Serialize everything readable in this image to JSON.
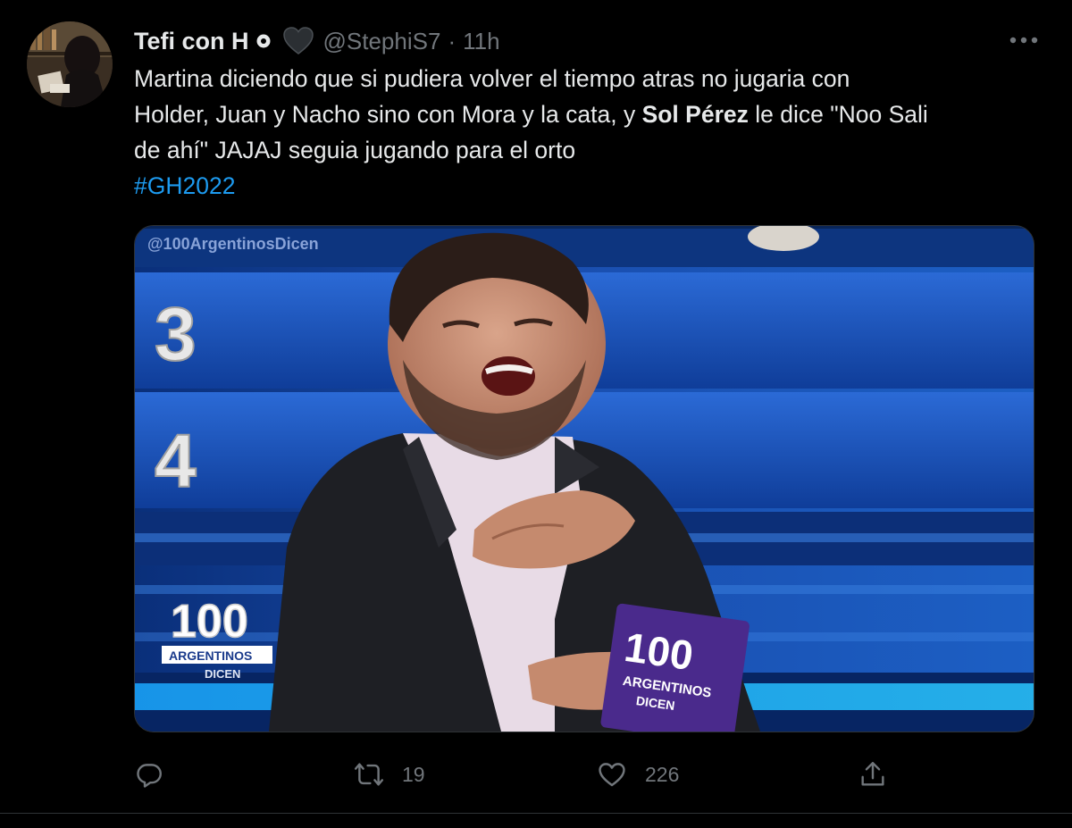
{
  "tweet": {
    "display_name": "Tefi con H",
    "handle": "@StephiS7",
    "separator": "·",
    "time": "11h",
    "text_line1": "Martina diciendo que si pudiera volver el tiempo atras no jugaria con",
    "text_line2_a": "Holder, Juan y Nacho sino con Mora y la cata, y ",
    "text_line2_bold": "Sol Pérez",
    "text_line2_b": " le dice \"Noo Sali",
    "text_line3": "de ahí\" JAJAJ seguia jugando para el orto",
    "hashtag": "#GH2022"
  },
  "media": {
    "board_numbers": [
      "3",
      "4"
    ],
    "watermark": "@100ArgentinosDicen",
    "logo_top": "100",
    "logo_mid": "ARGENTINOS",
    "logo_bottom": "DICEN",
    "card_top": "100",
    "card_mid": "ARGENTINOS",
    "card_bottom": "DICEN"
  },
  "actions": {
    "reply_count": "",
    "retweet_count": "19",
    "like_count": "226"
  },
  "icons": {
    "verified": "circle-badge-icon",
    "heart_emoji": "black-heart-icon",
    "more": "more-dots-icon",
    "reply": "reply-icon",
    "retweet": "retweet-icon",
    "like": "like-icon",
    "share": "share-icon"
  },
  "colors": {
    "background": "#000000",
    "text": "#e7e9ea",
    "secondary": "#71767b",
    "link": "#1d9bf0"
  }
}
